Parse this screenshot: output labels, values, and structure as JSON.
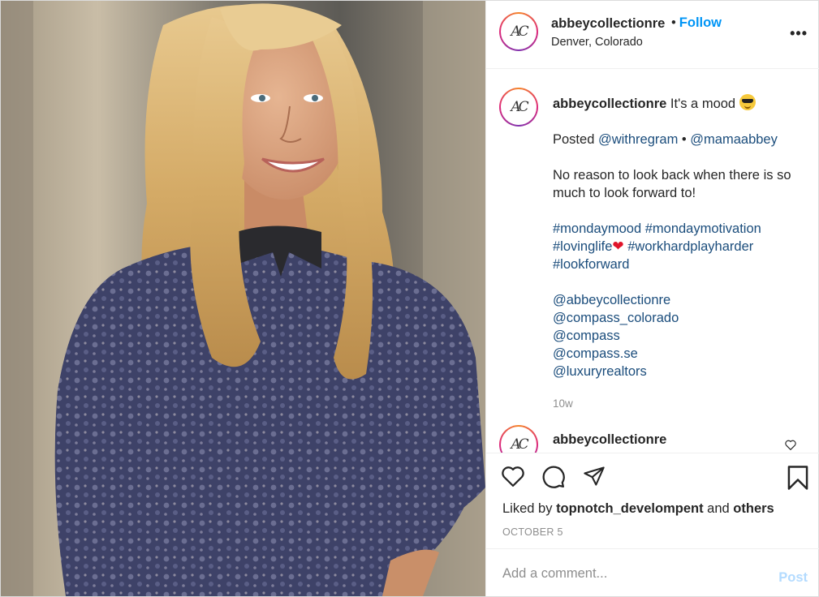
{
  "post": {
    "username": "abbeycollectionre",
    "avatar_monogram": "AC",
    "follow_separator": "•",
    "follow_label": "Follow",
    "location": "Denver, Colorado",
    "more_icon": "more-horizontal-icon",
    "more_label": "•••"
  },
  "caption": {
    "username": "abbeycollectionre",
    "text": "It's a mood",
    "emoji": "smiling-face-with-sunglasses",
    "posted_label": "Posted",
    "posted_via": "@withregram",
    "posted_sep": "•",
    "posted_author": "@mamaabbey",
    "body": "No reason to look back when there is so much to look forward to!",
    "hashtags_line1": "#mondaymood #mondaymotivation",
    "hashtag_lovinglife": "#lovinglife",
    "heart": "❤",
    "hashtag_workhard": "#workhardplayharder",
    "hashtag_lookforward": "#lookforward",
    "mentions": [
      "@abbeycollectionre",
      "@compass_colorado",
      "@compass",
      "@compass.se",
      "@luxuryrealtors"
    ],
    "age": "10w"
  },
  "comment2": {
    "username": "abbeycollectionre"
  },
  "actions": {
    "liked_prefix": "Liked by",
    "liked_user": "topnotch_develompent",
    "liked_and": "and",
    "liked_others": "others",
    "date": "OCTOBER 5"
  },
  "composer": {
    "placeholder": "Add a comment...",
    "post_label": "Post"
  },
  "colors": {
    "link": "#1b4d7c",
    "follow": "#0095f6",
    "post_disabled": "#b3dbff",
    "muted": "#8e8e8e"
  }
}
